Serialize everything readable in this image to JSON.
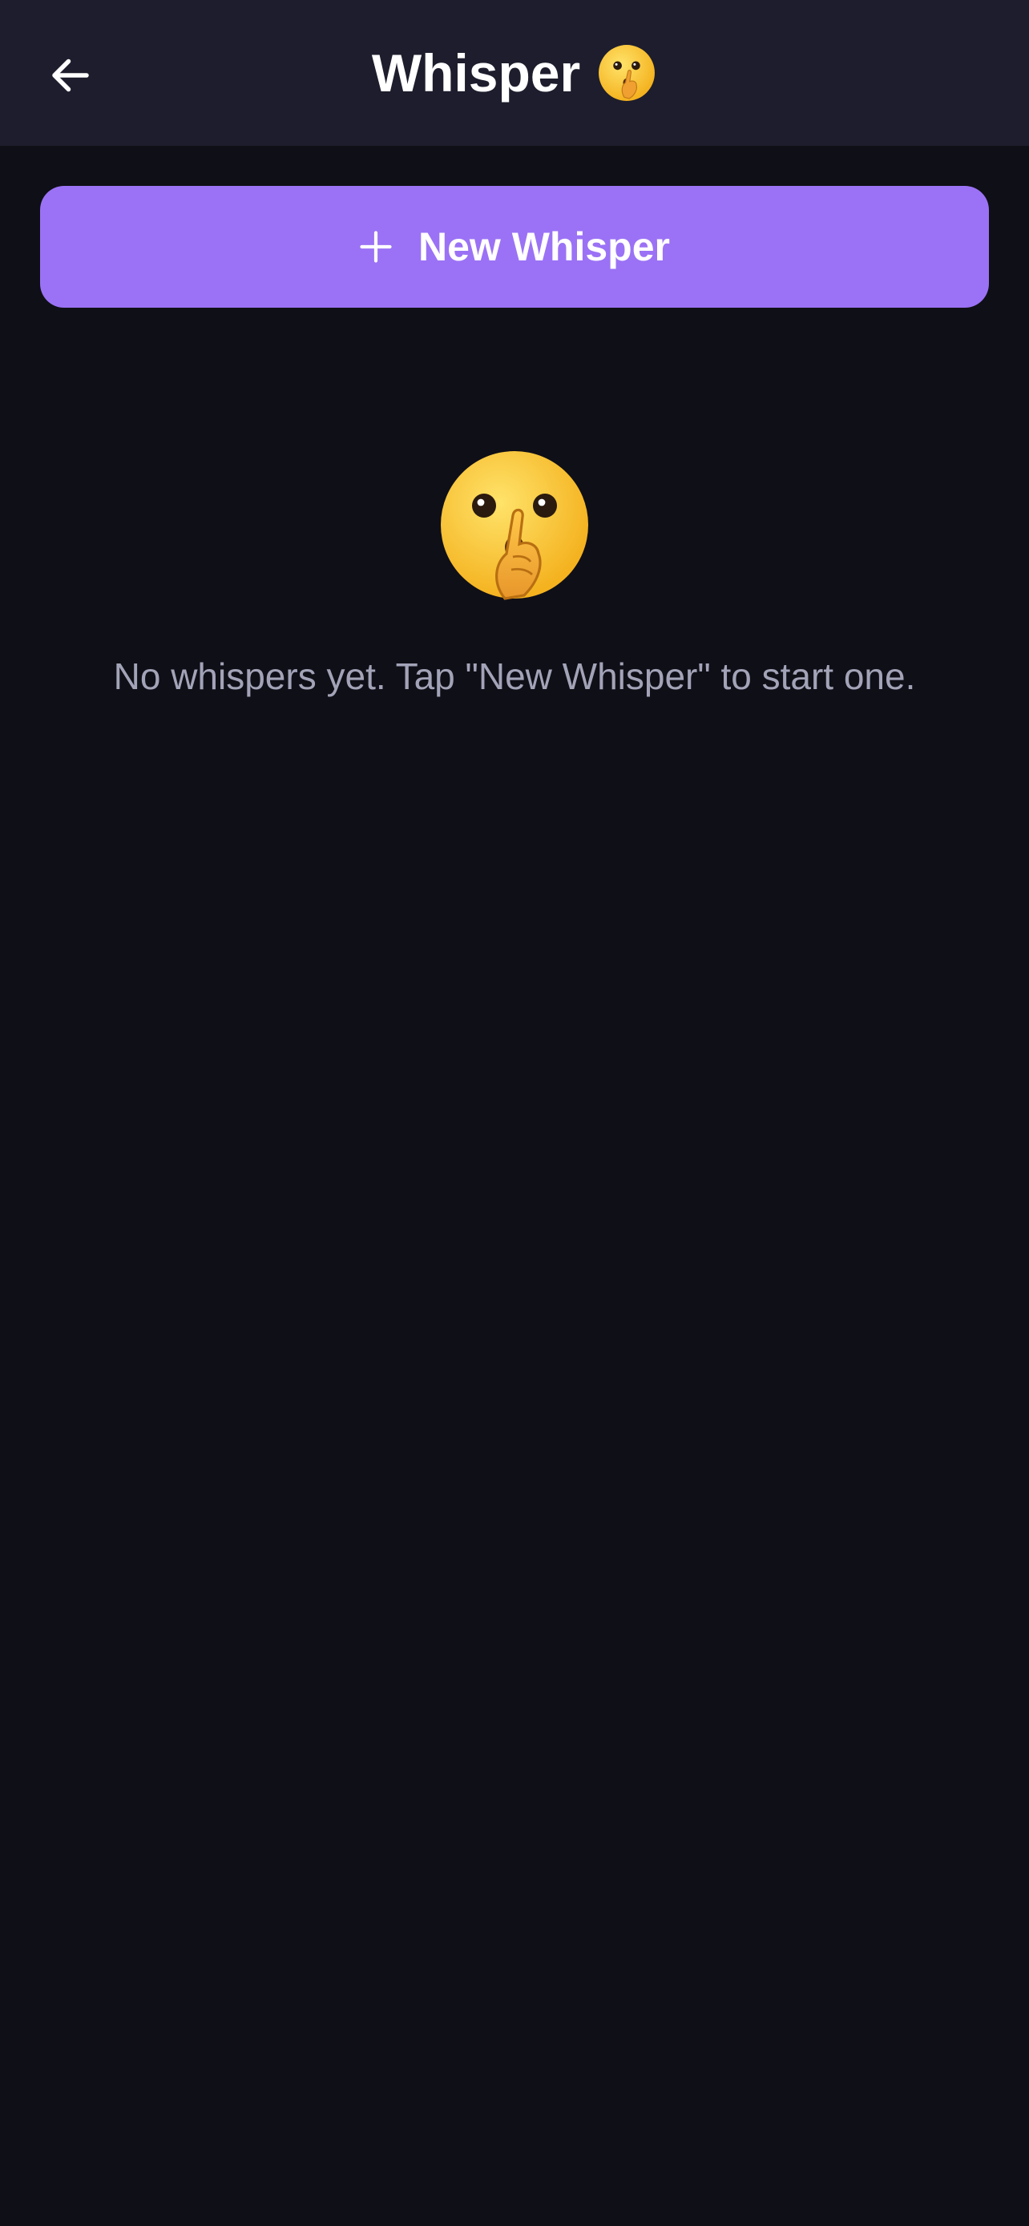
{
  "header": {
    "title": "Whisper",
    "back_icon": "arrow-left-icon",
    "title_icon": "shushing-face-icon"
  },
  "actions": {
    "new_whisper_label": "New Whisper",
    "new_whisper_icon": "plus-icon"
  },
  "empty_state": {
    "icon": "shushing-face-icon",
    "message": "No whispers yet. Tap \"New Whisper\" to start one."
  },
  "colors": {
    "background": "#0f0f17",
    "app_bar": "#1d1d2d",
    "accent": "#9b72f5",
    "muted_text": "#a3a3b8"
  }
}
